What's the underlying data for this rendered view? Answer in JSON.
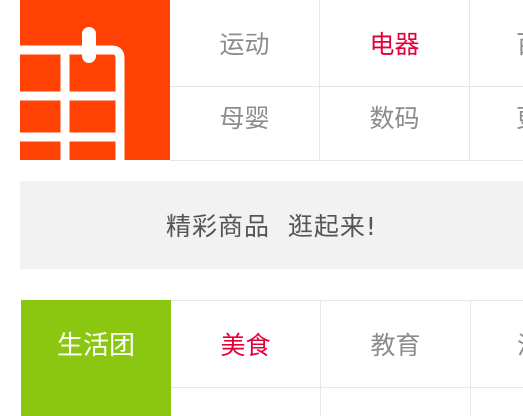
{
  "top_section": {
    "tile_icon": "cart-icon",
    "tile_color": "#ff4203",
    "categories": [
      {
        "label": "运动",
        "hot": false
      },
      {
        "label": "电器",
        "hot": true
      },
      {
        "label": "百",
        "hot": false
      },
      {
        "label": "母婴",
        "hot": false
      },
      {
        "label": "数码",
        "hot": false
      },
      {
        "label": "更",
        "hot": false
      }
    ]
  },
  "banner": {
    "text": "精彩商品  逛起来!"
  },
  "bottom_section": {
    "tile_label": "生活团",
    "tile_color": "#8bc710",
    "categories": [
      {
        "label": "美食",
        "hot": true
      },
      {
        "label": "教育",
        "hot": false
      },
      {
        "label": "汽",
        "hot": false
      }
    ]
  },
  "colors": {
    "hot_text": "#e4003a",
    "muted_text": "#8c8c8c",
    "divider": "#e7e7e7",
    "banner_bg": "#f2f2f2"
  }
}
